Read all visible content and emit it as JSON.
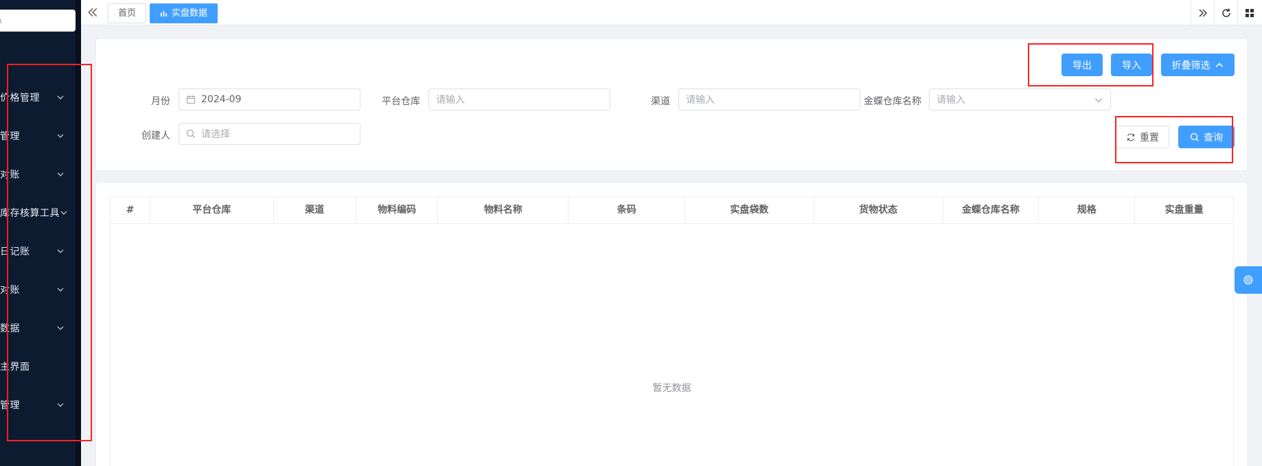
{
  "sidebar": {
    "search_placeholder": "\\",
    "items": [
      {
        "label": "价格管理",
        "expandable": true
      },
      {
        "label": "管理",
        "expandable": true
      },
      {
        "label": "对账",
        "expandable": true
      },
      {
        "label": "库存核算工具",
        "expandable": true
      },
      {
        "label": "日记账",
        "expandable": true
      },
      {
        "label": "对账",
        "expandable": true
      },
      {
        "label": "数据",
        "expandable": true
      },
      {
        "label": "主界面",
        "expandable": false
      },
      {
        "label": "管理",
        "expandable": true
      }
    ]
  },
  "tabs": {
    "home": "首页",
    "active": "实盘数据"
  },
  "toolbar": {
    "export": "导出",
    "import": "导入",
    "collapse_filter": "折叠筛选",
    "reset": "重置",
    "query": "查询"
  },
  "filters": {
    "month": {
      "label": "月份",
      "value": "2024-09"
    },
    "platform_warehouse": {
      "label": "平台仓库",
      "placeholder": "请输入"
    },
    "channel": {
      "label": "渠道",
      "placeholder": "请输入"
    },
    "kingdee_warehouse": {
      "label": "金蝶仓库名称",
      "placeholder": "请输入"
    },
    "creator": {
      "label": "创建人",
      "placeholder": "请选择"
    }
  },
  "table": {
    "columns": [
      "#",
      "平台仓库",
      "渠道",
      "物料编码",
      "物料名称",
      "条码",
      "实盘袋数",
      "货物状态",
      "金蝶仓库名称",
      "规格",
      "实盘重量"
    ],
    "empty_text": "暂无数据"
  },
  "colors": {
    "primary": "#409eff",
    "sidebar_bg": "#0c1b30",
    "annotation": "#ff1f1f"
  }
}
